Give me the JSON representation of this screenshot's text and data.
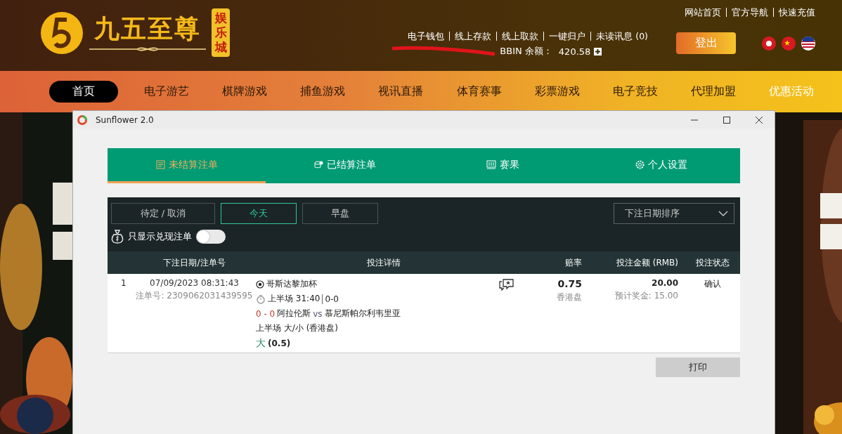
{
  "site": {
    "logo": {
      "name": "九五至尊",
      "badge": "娱乐城"
    },
    "top_links": [
      "网站首页",
      "官方导航",
      "快速充值"
    ],
    "account_links": [
      "电子钱包",
      "线上存款",
      "线上取款",
      "一键归户",
      "未读讯息 (0)"
    ],
    "balance": {
      "label": "BBIN 余额：",
      "value": "420.58"
    },
    "logout": "登出",
    "nav": [
      {
        "label": "首页",
        "selected": true
      },
      {
        "label": "电子游艺",
        "selected": false
      },
      {
        "label": "棋牌游戏",
        "selected": false
      },
      {
        "label": "捕鱼游戏",
        "selected": false
      },
      {
        "label": "视讯直播",
        "selected": false
      },
      {
        "label": "体育赛事",
        "selected": false
      },
      {
        "label": "彩票游戏",
        "selected": false
      },
      {
        "label": "电子竞技",
        "selected": false
      },
      {
        "label": "代理加盟",
        "selected": false
      },
      {
        "label": "优惠活动",
        "selected": false
      }
    ]
  },
  "window": {
    "title": "Sunflower 2.0",
    "tabs": [
      {
        "label": "未结算注单",
        "kind": "list",
        "selected": true
      },
      {
        "label": "已结算注单",
        "kind": "coins",
        "selected": false
      },
      {
        "label": "赛果",
        "kind": "board",
        "selected": false
      },
      {
        "label": "个人设置",
        "kind": "gear",
        "selected": false
      }
    ],
    "filters": [
      {
        "label": "待定 / 取消",
        "selected": false
      },
      {
        "label": "今天",
        "selected": true
      },
      {
        "label": "早盘",
        "selected": false
      }
    ],
    "sort": {
      "value": "下注日期排序"
    },
    "toggle": {
      "label": "只显示兑现注单",
      "on": false
    },
    "table": {
      "columns": [
        "下注日期/注单号",
        "投注详情",
        "赔率",
        "投注金额 (RMB)",
        "投注状态"
      ],
      "rows": [
        {
          "index": "1",
          "date": "07/09/2023 08:31:43",
          "bet_no": "注单号: 2309062031439595",
          "league": "哥斯达黎加杯",
          "period": "上半场 31:40",
          "score": "0-0",
          "match_score": "0 - 0",
          "home": "阿拉伦斯",
          "vs": "vs",
          "away": "慕尼斯帕尔利韦里亚",
          "market": "上半场 大/小 (香港盘)",
          "pick": "大",
          "line": "(0.5)",
          "odds": "0.75",
          "odds_type": "香港盘",
          "stake": "20.00",
          "payout": "预计奖金: 15.00",
          "status": "确认"
        }
      ]
    },
    "print": "打印"
  }
}
